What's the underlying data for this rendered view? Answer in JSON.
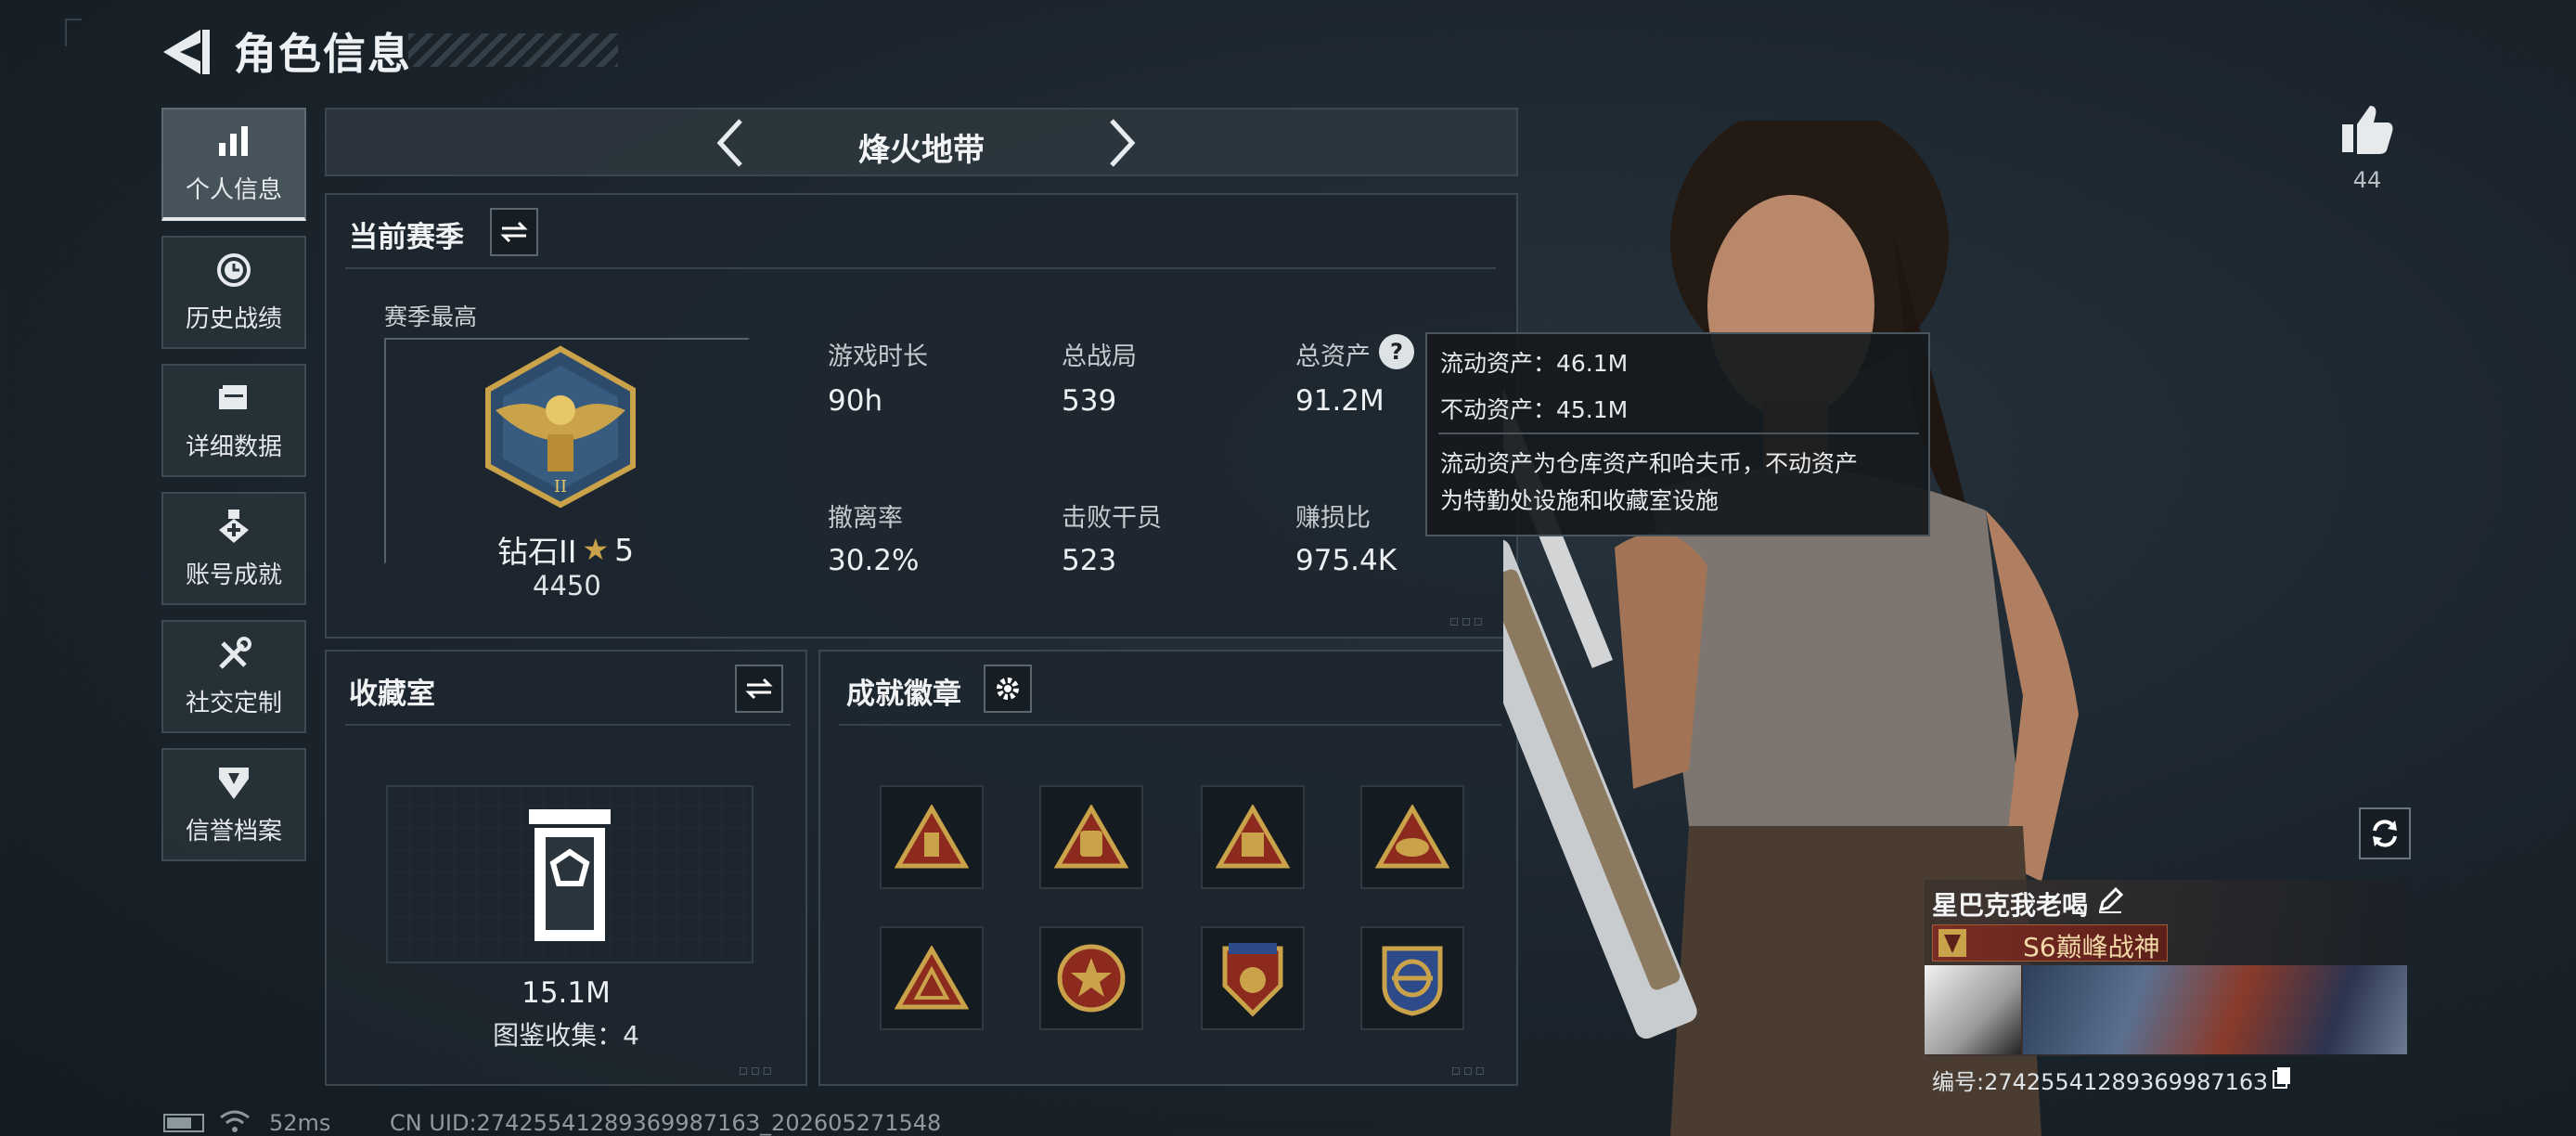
{
  "header": {
    "title": "角色信息"
  },
  "sidebar": {
    "items": [
      {
        "label": "个人信息",
        "icon": "bar-chart-icon",
        "active": true
      },
      {
        "label": "历史战绩",
        "icon": "history-clock-icon",
        "active": false
      },
      {
        "label": "详细数据",
        "icon": "folder-icon",
        "active": false
      },
      {
        "label": "账号成就",
        "icon": "achievement-icon",
        "active": false
      },
      {
        "label": "社交定制",
        "icon": "tools-icon",
        "active": false
      },
      {
        "label": "信誉档案",
        "icon": "credit-shield-icon",
        "active": false
      }
    ]
  },
  "mode": {
    "label": "烽火地带"
  },
  "season": {
    "title": "当前赛季",
    "best_label": "赛季最高",
    "rank_name": "钻石II",
    "rank_stars": "5",
    "rank_points": "4450",
    "stats": [
      {
        "label": "游戏时长",
        "value": "90h"
      },
      {
        "label": "总战局",
        "value": "539"
      },
      {
        "label": "总资产",
        "value": "91.2M"
      },
      {
        "label": "撤离率",
        "value": "30.2%"
      },
      {
        "label": "击败干员",
        "value": "523"
      },
      {
        "label": "赚损比",
        "value": "975.4K"
      }
    ]
  },
  "tooltip": {
    "liquid": "流动资产：46.1M",
    "fixed": "不动资产：45.1M",
    "desc_line1": "流动资产为仓库资产和哈夫币，不动资产",
    "desc_line2": "为特勤处设施和收藏室设施"
  },
  "collection": {
    "title": "收藏室",
    "value": "15.1M",
    "catalog": "图鉴收集：4"
  },
  "achievements": {
    "title": "成就徽章",
    "badges": [
      "triangle-badge-1",
      "triangle-badge-2",
      "triangle-badge-3",
      "triangle-badge-4",
      "triangle-badge-5",
      "round-badge-6",
      "shield-badge-7",
      "round-badge-8"
    ]
  },
  "likes": {
    "count": "44"
  },
  "player": {
    "name": "星巴克我老喝",
    "title": "S6巅峰战神",
    "id": "编号:2742554128936998716З"
  },
  "footer": {
    "ping": "52ms",
    "uid": "CN UID:2742554128936998716З_202605271548"
  },
  "colors": {
    "accent_gold": "#c9a24a",
    "badge_red": "#8c2a1e",
    "panel_bg": "#1e272f"
  }
}
